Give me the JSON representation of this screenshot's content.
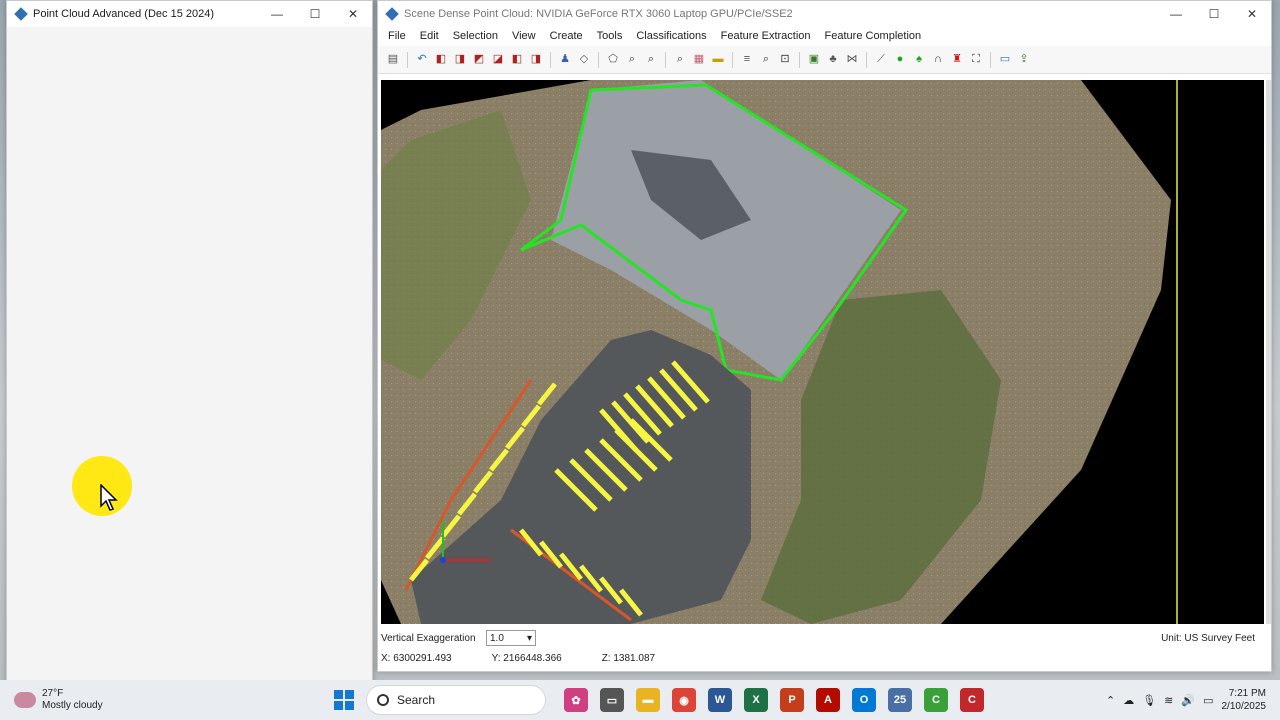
{
  "left_window": {
    "title": "Point Cloud Advanced (Dec 15 2024)",
    "controls": {
      "minimize": "—",
      "maximize": "☐",
      "close": "✕"
    }
  },
  "right_window": {
    "title": "Scene Dense Point Cloud: NVIDIA GeForce RTX 3060 Laptop GPU/PCIe/SSE2",
    "controls": {
      "minimize": "—",
      "maximize": "☐",
      "close": "✕"
    },
    "menu": [
      "File",
      "Edit",
      "Selection",
      "View",
      "Create",
      "Tools",
      "Classifications",
      "Feature Extraction",
      "Feature Completion"
    ],
    "toolbar_icons": [
      {
        "name": "layout-icon",
        "glyph": "▤",
        "color": "#555"
      },
      {
        "name": "undo-icon",
        "glyph": "↶",
        "color": "#2a6fc2"
      },
      {
        "name": "cube-icon",
        "glyph": "◧",
        "color": "#b02020"
      },
      {
        "name": "cube-front-icon",
        "glyph": "◨",
        "color": "#b02020"
      },
      {
        "name": "cube-top-icon",
        "glyph": "◩",
        "color": "#b02020"
      },
      {
        "name": "cube-side-icon",
        "glyph": "◪",
        "color": "#b02020"
      },
      {
        "name": "cube-back-icon",
        "glyph": "◧",
        "color": "#b02020"
      },
      {
        "name": "cube-iso-icon",
        "glyph": "◨",
        "color": "#b02020"
      },
      {
        "name": "person-icon",
        "glyph": "♟",
        "color": "#3a5fb0"
      },
      {
        "name": "select-icon",
        "glyph": "◇",
        "color": "#555"
      },
      {
        "name": "polygon-icon",
        "glyph": "⬠",
        "color": "#555"
      },
      {
        "name": "zoom-icon",
        "glyph": "⌕",
        "color": "#333"
      },
      {
        "name": "zoom-extents-icon",
        "glyph": "⌕",
        "color": "#333"
      },
      {
        "name": "zoom-in-icon",
        "glyph": "⌕",
        "color": "#333"
      },
      {
        "name": "document-icon",
        "glyph": "▦",
        "color": "#c06070"
      },
      {
        "name": "ruler-icon",
        "glyph": "▬",
        "color": "#c9a000"
      },
      {
        "name": "layers-icon",
        "glyph": "≡",
        "color": "#555"
      },
      {
        "name": "search-area-icon",
        "glyph": "⌕",
        "color": "#333"
      },
      {
        "name": "search-box-icon",
        "glyph": "⊡",
        "color": "#333"
      },
      {
        "name": "building-icon",
        "glyph": "▣",
        "color": "#3b7a2a"
      },
      {
        "name": "tree-icon",
        "glyph": "♣",
        "color": "#555"
      },
      {
        "name": "path-icon",
        "glyph": "⋈",
        "color": "#555"
      },
      {
        "name": "line-icon",
        "glyph": "⟋",
        "color": "#555"
      },
      {
        "name": "green-circle-icon",
        "glyph": "●",
        "color": "#1aa51a"
      },
      {
        "name": "green-shape-icon",
        "glyph": "♠",
        "color": "#1aa51a"
      },
      {
        "name": "curve-icon",
        "glyph": "∩",
        "color": "#333"
      },
      {
        "name": "red-figure-icon",
        "glyph": "♜",
        "color": "#d01818"
      },
      {
        "name": "frame-icon",
        "glyph": "⛶",
        "color": "#333"
      },
      {
        "name": "monitor-icon",
        "glyph": "▭",
        "color": "#2a6fc2"
      },
      {
        "name": "export-icon",
        "glyph": "⇪",
        "color": "#3b7a2a"
      }
    ],
    "status": {
      "vertical_exaggeration_label": "Vertical Exaggeration",
      "vertical_exaggeration_value": "1.0",
      "unit": "Unit:  US Survey Feet",
      "x": "X: 6300291.493",
      "y": "Y: 2166448.366",
      "z": "Z: 1381.087"
    },
    "colors": {
      "boundary": "#22e622",
      "parking_stripes": "#f5f542",
      "curb": "#d8572a",
      "guide_line": "#e8e84a"
    }
  },
  "taskbar": {
    "weather_temp": "27°F",
    "weather_desc": "Mostly cloudy",
    "search_label": "Search",
    "time": "7:21 PM",
    "date": "2/10/2025",
    "apps": [
      {
        "name": "flower-widget-icon",
        "glyph": "✿",
        "color": "#d04080"
      },
      {
        "name": "task-view-icon",
        "glyph": "▭",
        "color": "#555"
      },
      {
        "name": "file-explorer-icon",
        "glyph": "▬",
        "color": "#e8b422"
      },
      {
        "name": "chrome-icon",
        "glyph": "◉",
        "color": "#db4437"
      },
      {
        "name": "word-icon",
        "glyph": "W",
        "color": "#2b5797"
      },
      {
        "name": "excel-icon",
        "glyph": "X",
        "color": "#1e7145"
      },
      {
        "name": "powerpoint-icon",
        "glyph": "P",
        "color": "#c43e1c"
      },
      {
        "name": "acrobat-icon",
        "glyph": "A",
        "color": "#b30b00"
      },
      {
        "name": "outlook-icon",
        "glyph": "O",
        "color": "#0078d4"
      },
      {
        "name": "app25-icon",
        "glyph": "25",
        "color": "#4a6fa5"
      },
      {
        "name": "green-app-icon",
        "glyph": "C",
        "color": "#3aa03a"
      },
      {
        "name": "red-app-icon",
        "glyph": "C",
        "color": "#c0282c"
      }
    ]
  }
}
